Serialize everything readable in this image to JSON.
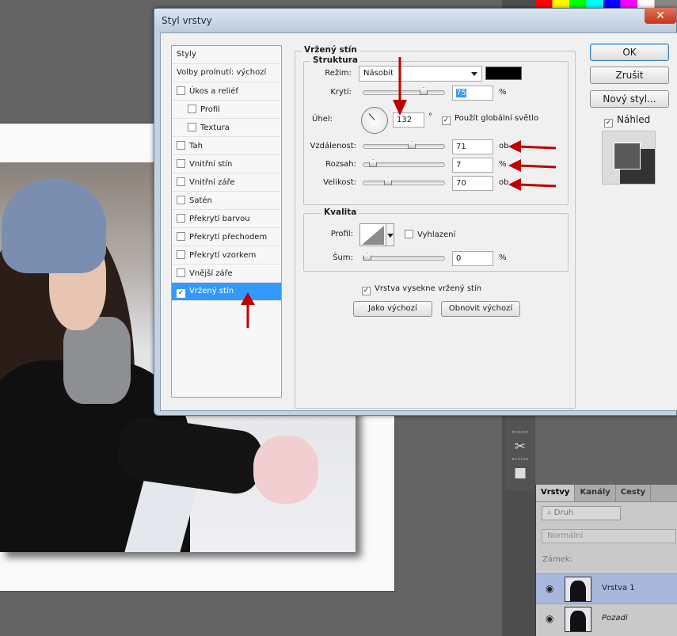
{
  "dialog": {
    "title": "Styl vrstvy",
    "close_label": "✕",
    "styles_list": {
      "header": "Styly",
      "blend_options": "Volby prolnutí: výchozí",
      "items": [
        {
          "label": "Úkos a reliéf",
          "checked": false,
          "indent": false
        },
        {
          "label": "Profil",
          "checked": false,
          "indent": true
        },
        {
          "label": "Textura",
          "checked": false,
          "indent": true
        },
        {
          "label": "Tah",
          "checked": false,
          "indent": false
        },
        {
          "label": "Vnitřní stín",
          "checked": false,
          "indent": false
        },
        {
          "label": "Vnitřní záře",
          "checked": false,
          "indent": false
        },
        {
          "label": "Satén",
          "checked": false,
          "indent": false
        },
        {
          "label": "Překrytí barvou",
          "checked": false,
          "indent": false
        },
        {
          "label": "Překrytí přechodem",
          "checked": false,
          "indent": false
        },
        {
          "label": "Překrytí vzorkem",
          "checked": false,
          "indent": false
        },
        {
          "label": "Vnější záře",
          "checked": false,
          "indent": false
        },
        {
          "label": "Vržený stín",
          "checked": true,
          "indent": false,
          "selected": true
        }
      ]
    },
    "drop_shadow": {
      "section_title": "Vržený stín",
      "structure": {
        "title": "Struktura",
        "mode_label": "Režim:",
        "mode_value": "Násobit",
        "shadow_color": "#000000",
        "opacity_label": "Krytí:",
        "opacity_value": "75",
        "opacity_unit": "%",
        "angle_label": "Úhel:",
        "angle_value": "132",
        "angle_unit": "°",
        "global_light_label": "Použít globální světlo",
        "global_light_checked": true,
        "distance_label": "Vzdálenost:",
        "distance_value": "71",
        "distance_unit": "ob",
        "spread_label": "Rozsah:",
        "spread_value": "7",
        "spread_unit": "%",
        "size_label": "Velikost:",
        "size_value": "70",
        "size_unit": "ob"
      },
      "quality": {
        "title": "Kvalita",
        "contour_label": "Profil:",
        "anti_alias_label": "Vyhlazení",
        "anti_alias_checked": false,
        "noise_label": "Šum:",
        "noise_value": "0",
        "noise_unit": "%"
      },
      "knockout_label": "Vrstva vyseknе vržený stín",
      "knockout_checked": true,
      "make_default": "Jako výchozí",
      "reset_default": "Obnovit výchozí"
    },
    "buttons": {
      "ok": "OK",
      "cancel": "Zrušit",
      "new_style": "Nový styl...",
      "preview_label": "Náhled",
      "preview_checked": true
    }
  },
  "layers_panel": {
    "tabs": [
      "Vrstvy",
      "Kanály",
      "Cesty"
    ],
    "filter_placeholder": "Druh",
    "blend_mode": "Normální",
    "lock_label": "Zámek:",
    "layers": [
      {
        "name": "Vrstva 1",
        "selected": true,
        "italic": false
      },
      {
        "name": "Pozadí",
        "selected": false,
        "italic": true
      }
    ]
  },
  "colors": {
    "accent": "#3399ff",
    "arrow": "#c00000",
    "workspace": "#646464"
  }
}
